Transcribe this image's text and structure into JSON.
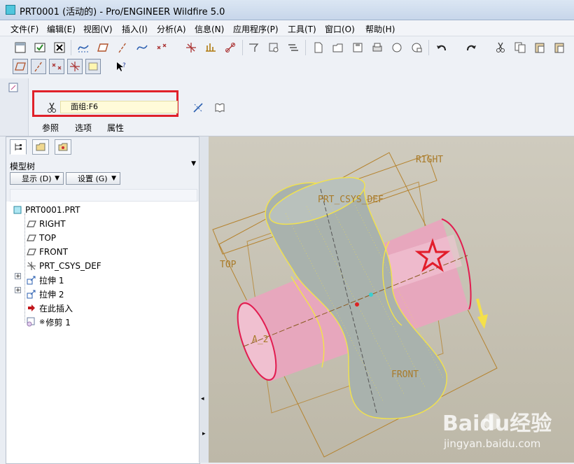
{
  "window": {
    "title": "PRT0001 (活动的) - Pro/ENGINEER Wildfire 5.0"
  },
  "menubar": {
    "items": [
      "文件(F)",
      "编辑(E)",
      "视图(V)",
      "插入(I)",
      "分析(A)",
      "信息(N)",
      "应用程序(P)",
      "工具(T)",
      "窗口(O)",
      "帮助(H)"
    ]
  },
  "toolbar": {
    "icons": [
      "new-window-icon",
      "regenerate-icon",
      "close-window-icon",
      "curve-query-icon",
      "plane-icon",
      "axis-icon",
      "curve-icon",
      "points-icon",
      "csys-icon",
      "analysis-icon",
      "pattern-link-icon",
      "view-manager-icon",
      "orient-icon",
      "layers-icon",
      "new-file-icon",
      "open-icon",
      "save-icon",
      "print-icon",
      "send-icon",
      "email-icon",
      "undo-icon",
      "redo-icon",
      "cut-icon",
      "copy-icon",
      "paste-icon",
      "paste-special-icon"
    ],
    "display_toggles": [
      "plane-display-icon",
      "axis-display-icon",
      "point-display-icon",
      "csys-display-icon",
      "annotation-display-icon"
    ],
    "help_icon": "context-help-icon"
  },
  "dashboard": {
    "collector_label": "面组:F6",
    "tabs": [
      "参照",
      "选项",
      "属性"
    ],
    "highlight_color": "#e0212a"
  },
  "model_tree": {
    "tabs": [
      "model-tree-icon",
      "folder-browser-icon",
      "favorites-icon"
    ],
    "caption": "模型树",
    "show_button": "显示 (D)",
    "settings_button": "设置 (G)",
    "items": [
      {
        "label": "PRT0001.PRT",
        "icon": "part-icon"
      },
      {
        "label": "RIGHT",
        "icon": "datum-plane-icon"
      },
      {
        "label": "TOP",
        "icon": "datum-plane-icon"
      },
      {
        "label": "FRONT",
        "icon": "datum-plane-icon"
      },
      {
        "label": "PRT_CSYS_DEF",
        "icon": "csys-icon"
      },
      {
        "label": "拉伸 1",
        "icon": "extrude-icon"
      },
      {
        "label": "拉伸 2",
        "icon": "extrude-icon"
      },
      {
        "label": "在此插入",
        "icon": "insert-here-icon"
      },
      {
        "label": "修剪 1",
        "icon": "trim-icon"
      }
    ]
  },
  "graphics": {
    "labels": {
      "right": "RIGHT",
      "top": "TOP",
      "front": "FRONT",
      "csys": "PRT_CSYS_DEF",
      "axis": "A_2"
    },
    "colors": {
      "cylinder": "#e7a7bd",
      "surface": "#a9b2ad",
      "datum": "#b5832f",
      "edge": "#f3e34a",
      "arrow": "#f4e04a"
    },
    "watermark": {
      "brand": "Baidu经验",
      "url": "jingyan.baidu.com"
    }
  }
}
